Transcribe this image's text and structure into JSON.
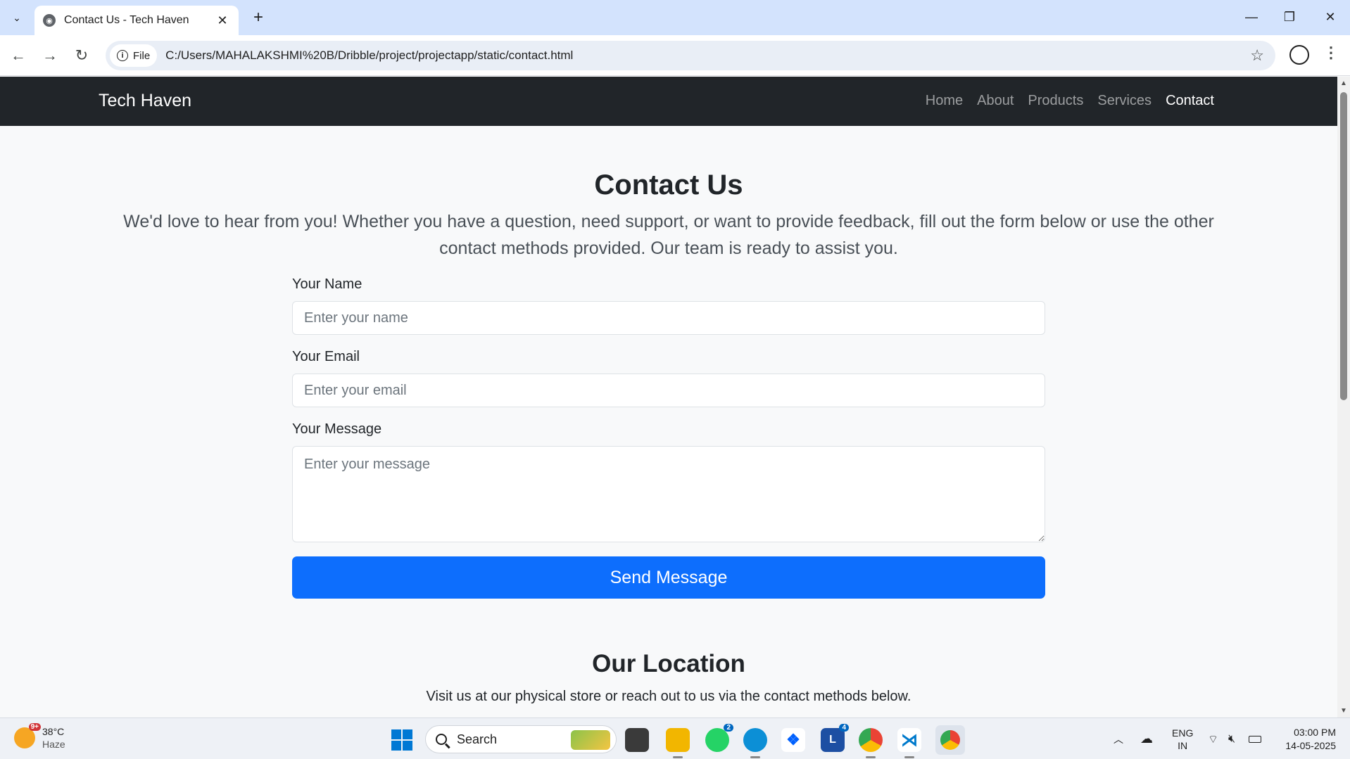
{
  "browser": {
    "tab_title": "Contact Us - Tech Haven",
    "site_chip": "File",
    "url": "C:/Users/MAHALAKSHMI%20B/Dribble/project/projectapp/static/contact.html"
  },
  "site": {
    "brand": "Tech Haven",
    "nav": [
      "Home",
      "About",
      "Products",
      "Services",
      "Contact"
    ],
    "active_nav": "Contact"
  },
  "contact": {
    "title": "Contact Us",
    "lead": "We'd love to hear from you! Whether you have a question, need support, or want to provide feedback, fill out the form below or use the other contact methods provided. Our team is ready to assist you.",
    "name_label": "Your Name",
    "name_placeholder": "Enter your name",
    "email_label": "Your Email",
    "email_placeholder": "Enter your email",
    "message_label": "Your Message",
    "message_placeholder": "Enter your message",
    "submit_label": "Send Message"
  },
  "location": {
    "title": "Our Location",
    "subtitle": "Visit us at our physical store or reach out to us via the contact methods below."
  },
  "taskbar": {
    "weather_badge": "9+",
    "temperature": "38°C",
    "condition": "Haze",
    "search_label": "Search",
    "whatsapp_badge": "2",
    "lens_badge": "4",
    "language": "ENG",
    "region": "IN",
    "time": "03:00 PM",
    "date": "14-05-2025"
  },
  "colors": {
    "navbar_bg": "#212529",
    "primary_button": "#0d6efd",
    "page_bg": "#f8f9fa",
    "browser_tabbar": "#d3e3fd"
  }
}
